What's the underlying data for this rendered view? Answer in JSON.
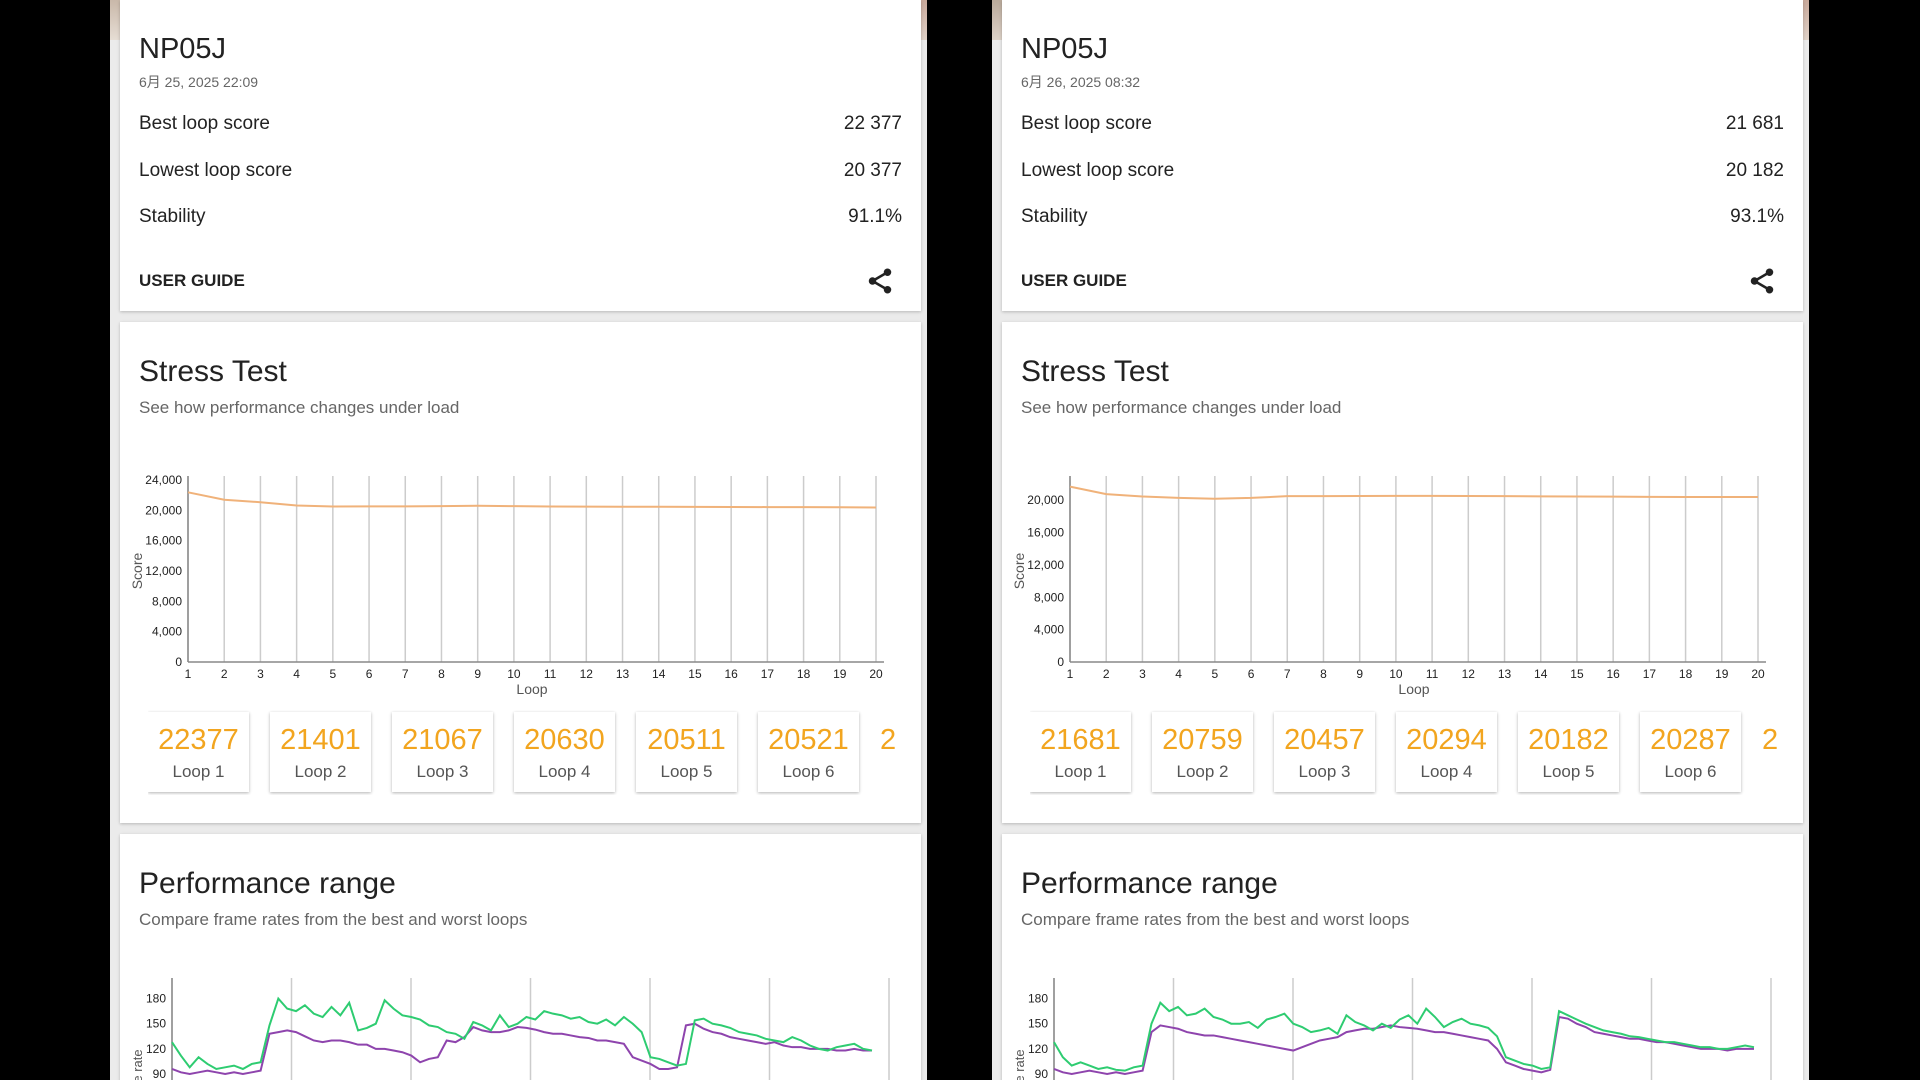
{
  "panels": [
    {
      "device": "NP05J",
      "date": "6月 25, 2025 22:09",
      "stats": [
        {
          "label": "Best loop score",
          "value": "22 377"
        },
        {
          "label": "Lowest loop score",
          "value": "20 377"
        },
        {
          "label": "Stability",
          "value": "91.1%"
        }
      ],
      "user_guide": "USER GUIDE",
      "share_icon": "share-icon",
      "stress": {
        "title": "Stress Test",
        "subtitle": "See how performance changes under load"
      },
      "chips": [
        {
          "score": "22377",
          "loop": "Loop 1"
        },
        {
          "score": "21401",
          "loop": "Loop 2"
        },
        {
          "score": "21067",
          "loop": "Loop 3"
        },
        {
          "score": "20630",
          "loop": "Loop 4"
        },
        {
          "score": "20511",
          "loop": "Loop 5"
        },
        {
          "score": "20521",
          "loop": "Loop 6"
        }
      ],
      "chip_more": "2",
      "perf": {
        "title": "Performance range",
        "subtitle": "Compare frame rates from the best and worst loops"
      }
    },
    {
      "device": "NP05J",
      "date": "6月 26, 2025 08:32",
      "stats": [
        {
          "label": "Best loop score",
          "value": "21 681"
        },
        {
          "label": "Lowest loop score",
          "value": "20 182"
        },
        {
          "label": "Stability",
          "value": "93.1%"
        }
      ],
      "user_guide": "USER GUIDE",
      "share_icon": "share-icon",
      "stress": {
        "title": "Stress Test",
        "subtitle": "See how performance changes under load"
      },
      "chips": [
        {
          "score": "21681",
          "loop": "Loop 1"
        },
        {
          "score": "20759",
          "loop": "Loop 2"
        },
        {
          "score": "20457",
          "loop": "Loop 3"
        },
        {
          "score": "20294",
          "loop": "Loop 4"
        },
        {
          "score": "20182",
          "loop": "Loop 5"
        },
        {
          "score": "20287",
          "loop": "Loop 6"
        }
      ],
      "chip_more": "2",
      "perf": {
        "title": "Performance range",
        "subtitle": "Compare frame rates from the best and worst loops"
      }
    }
  ],
  "colors": {
    "score_line": "#f0b27a",
    "chip_score": "#f2a51f",
    "best_loop": "#2ecc71",
    "worst_loop": "#8e44ad",
    "gridline": "#cccccc"
  },
  "chart_data": [
    {
      "type": "line",
      "xlabel": "Loop",
      "ylabel": "Score",
      "x": [
        1,
        2,
        3,
        4,
        5,
        6,
        7,
        8,
        9,
        10,
        11,
        12,
        13,
        14,
        15,
        16,
        17,
        18,
        19,
        20
      ],
      "xticks": [
        "1",
        "2",
        "3",
        "4",
        "5",
        "6",
        "7",
        "8",
        "9",
        "10",
        "11",
        "12",
        "13",
        "14",
        "15",
        "16",
        "17",
        "18",
        "19",
        "20"
      ],
      "yticks": [
        "0",
        "4,000",
        "8,000",
        "12,000",
        "16,000",
        "20,000",
        "24,000"
      ],
      "ylim": [
        0,
        24000
      ],
      "series": [
        {
          "values": [
            22377,
            21401,
            21067,
            20630,
            20511,
            20521,
            20530,
            20560,
            20600,
            20550,
            20500,
            20490,
            20480,
            20470,
            20450,
            20440,
            20430,
            20420,
            20400,
            20377
          ]
        }
      ]
    },
    {
      "type": "line",
      "xlabel": "Loop",
      "ylabel": "Score",
      "x": [
        1,
        2,
        3,
        4,
        5,
        6,
        7,
        8,
        9,
        10,
        11,
        12,
        13,
        14,
        15,
        16,
        17,
        18,
        19,
        20
      ],
      "xticks": [
        "1",
        "2",
        "3",
        "4",
        "5",
        "6",
        "7",
        "8",
        "9",
        "10",
        "11",
        "12",
        "13",
        "14",
        "15",
        "16",
        "17",
        "18",
        "19",
        "20"
      ],
      "yticks": [
        "0",
        "4,000",
        "8,000",
        "12,000",
        "16,000",
        "20,000"
      ],
      "ylim": [
        0,
        22500
      ],
      "series": [
        {
          "values": [
            21681,
            20759,
            20457,
            20294,
            20182,
            20287,
            20500,
            20510,
            20520,
            20530,
            20540,
            20520,
            20500,
            20480,
            20460,
            20440,
            20420,
            20400,
            20400,
            20400
          ]
        }
      ]
    },
    {
      "type": "line",
      "ylabel": "e rate",
      "yticks": [
        "90",
        "120",
        "150",
        "180"
      ],
      "ylim": [
        90,
        195
      ],
      "series": [
        {
          "values": [
            128,
            112,
            98,
            110,
            102,
            96,
            98,
            100,
            96,
            102,
            104,
            148,
            180,
            168,
            165,
            172,
            162,
            158,
            170,
            160,
            175,
            142,
            145,
            150,
            178,
            168,
            160,
            158,
            155,
            148,
            146,
            140,
            138,
            132,
            152,
            148,
            142,
            160,
            146,
            150,
            158,
            155,
            165,
            162,
            160,
            156,
            158,
            152,
            150,
            155,
            148,
            158,
            150,
            140,
            110,
            108,
            104,
            100,
            102,
            154,
            156,
            150,
            148,
            145,
            140,
            138,
            136,
            132,
            130,
            128,
            134,
            130,
            124,
            120,
            118,
            122,
            124,
            126,
            120,
            118
          ]
        },
        {
          "values": [
            96,
            92,
            90,
            92,
            94,
            92,
            90,
            92,
            90,
            92,
            94,
            138,
            140,
            142,
            140,
            135,
            130,
            128,
            130,
            130,
            128,
            125,
            125,
            120,
            120,
            118,
            116,
            112,
            104,
            108,
            110,
            130,
            128,
            134,
            146,
            142,
            140,
            140,
            142,
            146,
            145,
            143,
            140,
            138,
            138,
            136,
            134,
            133,
            130,
            130,
            128,
            126,
            110,
            106,
            102,
            96,
            96,
            98,
            148,
            150,
            144,
            140,
            138,
            134,
            132,
            130,
            128,
            126,
            128,
            124,
            122,
            122,
            120,
            120,
            120,
            118,
            118,
            120,
            118,
            118
          ]
        }
      ]
    },
    {
      "type": "line",
      "ylabel": "e rate",
      "yticks": [
        "90",
        "120",
        "150",
        "180"
      ],
      "ylim": [
        90,
        195
      ],
      "series": [
        {
          "values": [
            128,
            110,
            100,
            104,
            100,
            96,
            98,
            95,
            94,
            98,
            100,
            150,
            175,
            165,
            170,
            160,
            162,
            168,
            158,
            155,
            150,
            150,
            152,
            145,
            155,
            158,
            162,
            150,
            146,
            140,
            142,
            145,
            138,
            160,
            152,
            148,
            142,
            150,
            145,
            155,
            160,
            150,
            168,
            158,
            146,
            152,
            156,
            150,
            148,
            145,
            135,
            110,
            106,
            102,
            100,
            96,
            98,
            165,
            160,
            155,
            150,
            146,
            142,
            140,
            138,
            135,
            134,
            132,
            130,
            128,
            128,
            126,
            124,
            122,
            122,
            120,
            120,
            122,
            124,
            122
          ]
        },
        {
          "values": [
            96,
            92,
            90,
            92,
            94,
            92,
            90,
            92,
            90,
            92,
            94,
            140,
            148,
            146,
            144,
            140,
            138,
            136,
            136,
            134,
            132,
            130,
            128,
            126,
            124,
            122,
            120,
            118,
            122,
            126,
            130,
            132,
            134,
            140,
            142,
            144,
            144,
            146,
            148,
            146,
            145,
            144,
            142,
            140,
            140,
            138,
            136,
            134,
            132,
            130,
            120,
            104,
            100,
            96,
            94,
            92,
            95,
            158,
            156,
            150,
            146,
            140,
            138,
            136,
            134,
            132,
            132,
            130,
            128,
            128,
            126,
            124,
            122,
            120,
            120,
            120,
            118,
            120,
            120,
            120
          ]
        }
      ]
    }
  ]
}
